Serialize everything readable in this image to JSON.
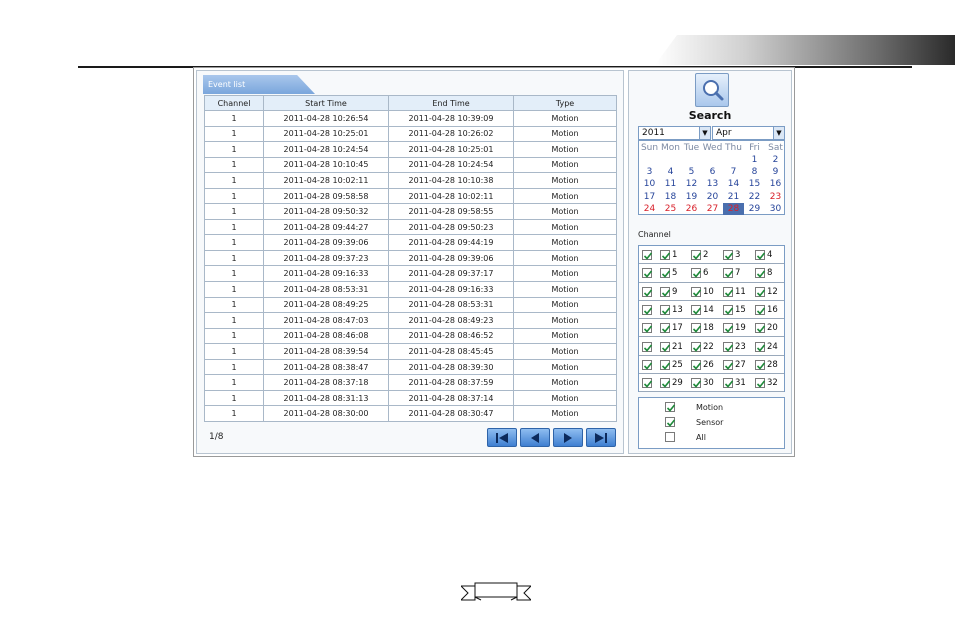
{
  "event_list": {
    "tab_label": "Event list",
    "columns": [
      "Channel",
      "Start Time",
      "End Time",
      "Type"
    ],
    "rows": [
      [
        "1",
        "2011-04-28 10:26:54",
        "2011-04-28 10:39:09",
        "Motion"
      ],
      [
        "1",
        "2011-04-28 10:25:01",
        "2011-04-28 10:26:02",
        "Motion"
      ],
      [
        "1",
        "2011-04-28 10:24:54",
        "2011-04-28 10:25:01",
        "Motion"
      ],
      [
        "1",
        "2011-04-28 10:10:45",
        "2011-04-28 10:24:54",
        "Motion"
      ],
      [
        "1",
        "2011-04-28 10:02:11",
        "2011-04-28 10:10:38",
        "Motion"
      ],
      [
        "1",
        "2011-04-28 09:58:58",
        "2011-04-28 10:02:11",
        "Motion"
      ],
      [
        "1",
        "2011-04-28 09:50:32",
        "2011-04-28 09:58:55",
        "Motion"
      ],
      [
        "1",
        "2011-04-28 09:44:27",
        "2011-04-28 09:50:23",
        "Motion"
      ],
      [
        "1",
        "2011-04-28 09:39:06",
        "2011-04-28 09:44:19",
        "Motion"
      ],
      [
        "1",
        "2011-04-28 09:37:23",
        "2011-04-28 09:39:06",
        "Motion"
      ],
      [
        "1",
        "2011-04-28 09:16:33",
        "2011-04-28 09:37:17",
        "Motion"
      ],
      [
        "1",
        "2011-04-28 08:53:31",
        "2011-04-28 09:16:33",
        "Motion"
      ],
      [
        "1",
        "2011-04-28 08:49:25",
        "2011-04-28 08:53:31",
        "Motion"
      ],
      [
        "1",
        "2011-04-28 08:47:03",
        "2011-04-28 08:49:23",
        "Motion"
      ],
      [
        "1",
        "2011-04-28 08:46:08",
        "2011-04-28 08:46:52",
        "Motion"
      ],
      [
        "1",
        "2011-04-28 08:39:54",
        "2011-04-28 08:45:45",
        "Motion"
      ],
      [
        "1",
        "2011-04-28 08:38:47",
        "2011-04-28 08:39:30",
        "Motion"
      ],
      [
        "1",
        "2011-04-28 08:37:18",
        "2011-04-28 08:37:59",
        "Motion"
      ],
      [
        "1",
        "2011-04-28 08:31:13",
        "2011-04-28 08:37:14",
        "Motion"
      ],
      [
        "1",
        "2011-04-28 08:30:00",
        "2011-04-28 08:30:47",
        "Motion"
      ]
    ],
    "page_indicator": "1/8",
    "pager_buttons": [
      "first-page-icon",
      "prev-page-icon",
      "next-page-icon",
      "last-page-icon"
    ]
  },
  "search": {
    "icon": "magnifier-icon",
    "title": "Search",
    "year_value": "2011",
    "month_value": "Apr",
    "weekdays": [
      "Sun",
      "Mon",
      "Tue",
      "Wed",
      "Thu",
      "Fri",
      "Sat"
    ],
    "weeks": [
      [
        "",
        "",
        "",
        "",
        "",
        "1",
        "2"
      ],
      [
        "3",
        "4",
        "5",
        "6",
        "7",
        "8",
        "9"
      ],
      [
        "10",
        "11",
        "12",
        "13",
        "14",
        "15",
        "16"
      ],
      [
        "17",
        "18",
        "19",
        "20",
        "21",
        "22",
        "23"
      ],
      [
        "24",
        "25",
        "26",
        "27",
        "28",
        "29",
        "30"
      ]
    ],
    "highlighted_days": [
      "23",
      "24",
      "25",
      "26",
      "27",
      "28"
    ],
    "selected_day": "28"
  },
  "channels": {
    "label": "Channel",
    "rows": [
      [
        "1",
        "2",
        "3",
        "4"
      ],
      [
        "5",
        "6",
        "7",
        "8"
      ],
      [
        "9",
        "10",
        "11",
        "12"
      ],
      [
        "13",
        "14",
        "15",
        "16"
      ],
      [
        "17",
        "18",
        "19",
        "20"
      ],
      [
        "21",
        "22",
        "23",
        "24"
      ],
      [
        "25",
        "26",
        "27",
        "28"
      ],
      [
        "29",
        "30",
        "31",
        "32"
      ]
    ],
    "all_checked": true
  },
  "types": [
    {
      "label": "Motion",
      "checked": true
    },
    {
      "label": "Sensor",
      "checked": true
    },
    {
      "label": "All",
      "checked": false
    }
  ],
  "colors": {
    "accent": "#7aa6dc",
    "check": "#1f8a3a",
    "highlight_day": "#d8202a",
    "selected_bg": "#4a6fae"
  }
}
